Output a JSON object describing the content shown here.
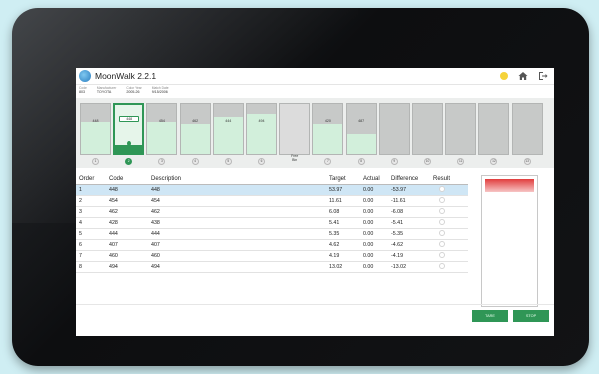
{
  "app": {
    "title": "MoonWalk 2.2.1",
    "status_color": "#f5d33a"
  },
  "info": [
    {
      "label": "Code",
      "value": "803"
    },
    {
      "label": "Manufacturer",
      "value": "TOYOTA"
    },
    {
      "label": "Color Year",
      "value": "2005-26"
    },
    {
      "label": "Match Date",
      "value": "9/15/2006"
    }
  ],
  "bins": [
    {
      "code": "448",
      "num": "1",
      "fill": 0.65
    },
    {
      "code": "448",
      "num": "2",
      "fill": 0.2,
      "active": true
    },
    {
      "code": "454",
      "num": "3",
      "fill": 0.65
    },
    {
      "code": "462",
      "num": "4",
      "fill": 0.6
    },
    {
      "code": "444",
      "num": "5",
      "fill": 0.75
    },
    {
      "code": "494",
      "num": "6",
      "fill": 0.8
    },
    {
      "code": "",
      "num": "",
      "label": "Free\nBin",
      "free": true,
      "fill": 0
    },
    {
      "code": "420",
      "num": "7",
      "fill": 0.6
    },
    {
      "code": "487",
      "num": "8",
      "fill": 0.4
    },
    {
      "code": "",
      "num": "9",
      "fill": 0
    },
    {
      "code": "",
      "num": "10",
      "fill": 0
    },
    {
      "code": "",
      "num": "11",
      "fill": 0
    },
    {
      "code": "",
      "num": "12",
      "fill": 0
    },
    {
      "code": "",
      "num": "13",
      "fill": 0
    }
  ],
  "table": {
    "headers": [
      "Order",
      "Code",
      "Description",
      "Target",
      "Actual",
      "Difference",
      "Result"
    ],
    "rows": [
      [
        "1",
        "448",
        "448",
        "53.97",
        "0.00",
        "-53.97"
      ],
      [
        "2",
        "454",
        "454",
        "11.61",
        "0.00",
        "-11.61"
      ],
      [
        "3",
        "462",
        "462",
        "6.08",
        "0.00",
        "-6.08"
      ],
      [
        "4",
        "428",
        "438",
        "5.41",
        "0.00",
        "-5.41"
      ],
      [
        "5",
        "444",
        "444",
        "5.35",
        "0.00",
        "-5.35"
      ],
      [
        "6",
        "407",
        "407",
        "4.62",
        "0.00",
        "-4.62"
      ],
      [
        "7",
        "460",
        "460",
        "4.19",
        "0.00",
        "-4.19"
      ],
      [
        "8",
        "494",
        "494",
        "13.02",
        "0.00",
        "-13.02"
      ]
    ]
  },
  "buttons": {
    "tare": "TARE",
    "stop": "STOP"
  }
}
